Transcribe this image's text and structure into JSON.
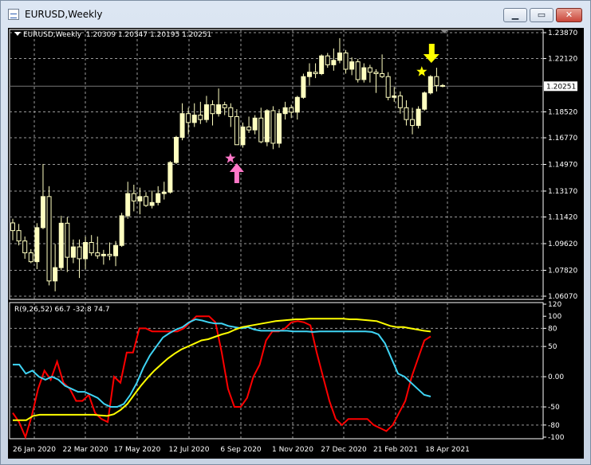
{
  "window": {
    "title": "EURUSD,Weekly",
    "minimize_label": "▁",
    "restore_label": "▭",
    "close_label": "✕"
  },
  "chart": {
    "header": {
      "symbol": "EURUSD,Weekly",
      "ohlc": "1.20309 1.20347 1.20195 1.20251"
    },
    "indicator_header": "R(9,26,52) 66.7 -32.8 74.7",
    "current_price_label": "1.20251",
    "colors": {
      "background": "#000000",
      "grid": "#9a9a9a",
      "candle": "#ffffc0",
      "up_candle": "#ffffc0",
      "down_candle": "#000000",
      "line_red": "#ff0000",
      "line_cyan": "#3fd4f4",
      "line_yellow": "#ffff00",
      "arrow_up": "#ff77c8",
      "arrow_down": "#ffff00",
      "star_pink": "#ff77c8",
      "star_yellow": "#ffff00"
    },
    "icons": {
      "arrow_up": "pink-up-arrow-icon",
      "arrow_down": "yellow-down-arrow-icon",
      "star_pink": "pink-star-icon",
      "star_yellow": "yellow-star-icon"
    }
  },
  "chart_data": [
    {
      "type": "candlestick",
      "title": "EURUSD,Weekly",
      "price_axis_ticks": [
        "1.23870",
        "1.22120",
        "1.20251",
        "1.18520",
        "1.16770",
        "1.14970",
        "1.13170",
        "1.11420",
        "1.09620",
        "1.07820",
        "1.06070"
      ],
      "ylim": [
        1.0607,
        1.2387
      ],
      "time_axis_ticks": [
        "26 Jan 2020",
        "22 Mar 2020",
        "17 May 2020",
        "12 Jul 2020",
        "6 Sep 2020",
        "1 Nov 2020",
        "27 Dec 2020",
        "21 Feb 2021",
        "18 Apr 2021"
      ],
      "candles": [
        {
          "o": 1.1102,
          "h": 1.113,
          "l": 1.0985,
          "c": 1.105
        },
        {
          "o": 1.105,
          "h": 1.1095,
          "l": 1.095,
          "c": 1.098
        },
        {
          "o": 1.098,
          "h": 1.101,
          "l": 1.086,
          "c": 1.09
        },
        {
          "o": 1.09,
          "h": 1.0925,
          "l": 1.083,
          "c": 1.084
        },
        {
          "o": 1.084,
          "h": 1.11,
          "l": 1.079,
          "c": 1.107
        },
        {
          "o": 1.107,
          "h": 1.15,
          "l": 1.106,
          "c": 1.128
        },
        {
          "o": 1.128,
          "h": 1.135,
          "l": 1.068,
          "c": 1.071
        },
        {
          "o": 1.071,
          "h": 1.096,
          "l": 1.064,
          "c": 1.08
        },
        {
          "o": 1.08,
          "h": 1.115,
          "l": 1.078,
          "c": 1.11
        },
        {
          "o": 1.11,
          "h": 1.114,
          "l": 1.077,
          "c": 1.087
        },
        {
          "o": 1.087,
          "h": 1.099,
          "l": 1.083,
          "c": 1.094
        },
        {
          "o": 1.094,
          "h": 1.099,
          "l": 1.073,
          "c": 1.086
        },
        {
          "o": 1.086,
          "h": 1.101,
          "l": 1.079,
          "c": 1.097
        },
        {
          "o": 1.097,
          "h": 1.102,
          "l": 1.088,
          "c": 1.09
        },
        {
          "o": 1.09,
          "h": 1.101,
          "l": 1.086,
          "c": 1.088
        },
        {
          "o": 1.088,
          "h": 1.092,
          "l": 1.082,
          "c": 1.089
        },
        {
          "o": 1.089,
          "h": 1.097,
          "l": 1.085,
          "c": 1.088
        },
        {
          "o": 1.088,
          "h": 1.098,
          "l": 1.081,
          "c": 1.095
        },
        {
          "o": 1.095,
          "h": 1.117,
          "l": 1.094,
          "c": 1.115
        },
        {
          "o": 1.115,
          "h": 1.138,
          "l": 1.113,
          "c": 1.13
        },
        {
          "o": 1.13,
          "h": 1.136,
          "l": 1.118,
          "c": 1.125
        },
        {
          "o": 1.125,
          "h": 1.134,
          "l": 1.116,
          "c": 1.128
        },
        {
          "o": 1.128,
          "h": 1.131,
          "l": 1.121,
          "c": 1.122
        },
        {
          "o": 1.122,
          "h": 1.132,
          "l": 1.12,
          "c": 1.124
        },
        {
          "o": 1.124,
          "h": 1.135,
          "l": 1.122,
          "c": 1.13
        },
        {
          "o": 1.13,
          "h": 1.138,
          "l": 1.126,
          "c": 1.131
        },
        {
          "o": 1.131,
          "h": 1.152,
          "l": 1.13,
          "c": 1.151
        },
        {
          "o": 1.151,
          "h": 1.169,
          "l": 1.15,
          "c": 1.168
        },
        {
          "o": 1.168,
          "h": 1.191,
          "l": 1.166,
          "c": 1.184
        },
        {
          "o": 1.184,
          "h": 1.188,
          "l": 1.17,
          "c": 1.178
        },
        {
          "o": 1.178,
          "h": 1.191,
          "l": 1.175,
          "c": 1.183
        },
        {
          "o": 1.183,
          "h": 1.192,
          "l": 1.177,
          "c": 1.18
        },
        {
          "o": 1.18,
          "h": 1.196,
          "l": 1.178,
          "c": 1.19
        },
        {
          "o": 1.19,
          "h": 1.193,
          "l": 1.176,
          "c": 1.184
        },
        {
          "o": 1.184,
          "h": 1.201,
          "l": 1.182,
          "c": 1.19
        },
        {
          "o": 1.19,
          "h": 1.192,
          "l": 1.183,
          "c": 1.188
        },
        {
          "o": 1.188,
          "h": 1.191,
          "l": 1.175,
          "c": 1.182
        },
        {
          "o": 1.182,
          "h": 1.187,
          "l": 1.169,
          "c": 1.163
        },
        {
          "o": 1.163,
          "h": 1.178,
          "l": 1.161,
          "c": 1.175
        },
        {
          "o": 1.175,
          "h": 1.182,
          "l": 1.171,
          "c": 1.173
        },
        {
          "o": 1.173,
          "h": 1.183,
          "l": 1.17,
          "c": 1.181
        },
        {
          "o": 1.181,
          "h": 1.188,
          "l": 1.164,
          "c": 1.165
        },
        {
          "o": 1.165,
          "h": 1.187,
          "l": 1.162,
          "c": 1.186
        },
        {
          "o": 1.186,
          "h": 1.189,
          "l": 1.16,
          "c": 1.164
        },
        {
          "o": 1.164,
          "h": 1.187,
          "l": 1.161,
          "c": 1.184
        },
        {
          "o": 1.184,
          "h": 1.192,
          "l": 1.18,
          "c": 1.188
        },
        {
          "o": 1.188,
          "h": 1.19,
          "l": 1.181,
          "c": 1.185
        },
        {
          "o": 1.185,
          "h": 1.196,
          "l": 1.18,
          "c": 1.195
        },
        {
          "o": 1.195,
          "h": 1.211,
          "l": 1.194,
          "c": 1.209
        },
        {
          "o": 1.209,
          "h": 1.218,
          "l": 1.203,
          "c": 1.212
        },
        {
          "o": 1.212,
          "h": 1.218,
          "l": 1.208,
          "c": 1.211
        },
        {
          "o": 1.211,
          "h": 1.224,
          "l": 1.21,
          "c": 1.223
        },
        {
          "o": 1.223,
          "h": 1.225,
          "l": 1.215,
          "c": 1.217
        },
        {
          "o": 1.217,
          "h": 1.228,
          "l": 1.213,
          "c": 1.22
        },
        {
          "o": 1.22,
          "h": 1.235,
          "l": 1.218,
          "c": 1.225
        },
        {
          "o": 1.225,
          "h": 1.227,
          "l": 1.211,
          "c": 1.214
        },
        {
          "o": 1.214,
          "h": 1.222,
          "l": 1.21,
          "c": 1.219
        },
        {
          "o": 1.219,
          "h": 1.221,
          "l": 1.205,
          "c": 1.207
        },
        {
          "o": 1.207,
          "h": 1.218,
          "l": 1.205,
          "c": 1.215
        },
        {
          "o": 1.215,
          "h": 1.217,
          "l": 1.205,
          "c": 1.212
        },
        {
          "o": 1.212,
          "h": 1.214,
          "l": 1.198,
          "c": 1.211
        },
        {
          "o": 1.211,
          "h": 1.224,
          "l": 1.208,
          "c": 1.209
        },
        {
          "o": 1.209,
          "h": 1.212,
          "l": 1.193,
          "c": 1.195
        },
        {
          "o": 1.195,
          "h": 1.202,
          "l": 1.192,
          "c": 1.196
        },
        {
          "o": 1.196,
          "h": 1.199,
          "l": 1.184,
          "c": 1.188
        },
        {
          "o": 1.188,
          "h": 1.193,
          "l": 1.176,
          "c": 1.18
        },
        {
          "o": 1.18,
          "h": 1.188,
          "l": 1.17,
          "c": 1.176
        },
        {
          "o": 1.176,
          "h": 1.189,
          "l": 1.174,
          "c": 1.187
        },
        {
          "o": 1.187,
          "h": 1.199,
          "l": 1.186,
          "c": 1.198
        },
        {
          "o": 1.198,
          "h": 1.21,
          "l": 1.197,
          "c": 1.209
        },
        {
          "o": 1.209,
          "h": 1.215,
          "l": 1.199,
          "c": 1.203
        },
        {
          "o": 1.203,
          "h": 1.204,
          "l": 1.2018,
          "c": 1.2025
        }
      ]
    },
    {
      "type": "line",
      "title": "R(9,26,52)",
      "values_label": "66.7 -32.8 74.7",
      "y_axis_ticks": [
        "120",
        "100",
        "80",
        "50",
        "0.00",
        "-50",
        "-80",
        "-100"
      ],
      "ylim": [
        -100,
        120
      ],
      "series": [
        {
          "color": "#ff0000",
          "values": [
            -60,
            -75,
            -100,
            -65,
            -20,
            10,
            -5,
            25,
            -10,
            -20,
            -40,
            -40,
            -30,
            -60,
            -70,
            -75,
            0,
            -10,
            40,
            40,
            80,
            80,
            75,
            75,
            75,
            75,
            75,
            80,
            90,
            100,
            100,
            100,
            90,
            40,
            -20,
            -50,
            -50,
            -35,
            0,
            20,
            60,
            75,
            75,
            80,
            90,
            92,
            90,
            85,
            40,
            0,
            -40,
            -70,
            -80,
            -70,
            -70,
            -70,
            -70,
            -80,
            -85,
            -90,
            -80,
            -60,
            -40,
            0,
            30,
            60,
            66.7
          ]
        },
        {
          "color": "#3fd4f4",
          "values": [
            20,
            20,
            5,
            10,
            0,
            -5,
            0,
            -5,
            -15,
            -20,
            -25,
            -25,
            -30,
            -35,
            -45,
            -50,
            -50,
            -45,
            -30,
            -10,
            15,
            35,
            50,
            65,
            72,
            78,
            82,
            90,
            95,
            93,
            90,
            88,
            88,
            84,
            82,
            80,
            82,
            78,
            76,
            76,
            76,
            76,
            76,
            75,
            75,
            75,
            74,
            75,
            75,
            75,
            75,
            75,
            75,
            75,
            75,
            74,
            70,
            55,
            30,
            5,
            0,
            -10,
            -20,
            -30,
            -32.8
          ]
        },
        {
          "color": "#ffff00",
          "values": [
            -72,
            -72,
            -72,
            -65,
            -63,
            -63,
            -63,
            -63,
            -63,
            -63,
            -63,
            -63,
            -63,
            -64,
            -65,
            -62,
            -55,
            -45,
            -30,
            -15,
            -2,
            10,
            20,
            30,
            38,
            45,
            50,
            55,
            60,
            62,
            66,
            70,
            73,
            78,
            82,
            84,
            86,
            88,
            90,
            92,
            93,
            94,
            95,
            95,
            96,
            96,
            96,
            96,
            96,
            96,
            95,
            95,
            94,
            93,
            92,
            88,
            84,
            82,
            82,
            80,
            78,
            76,
            74.7
          ]
        }
      ]
    }
  ]
}
